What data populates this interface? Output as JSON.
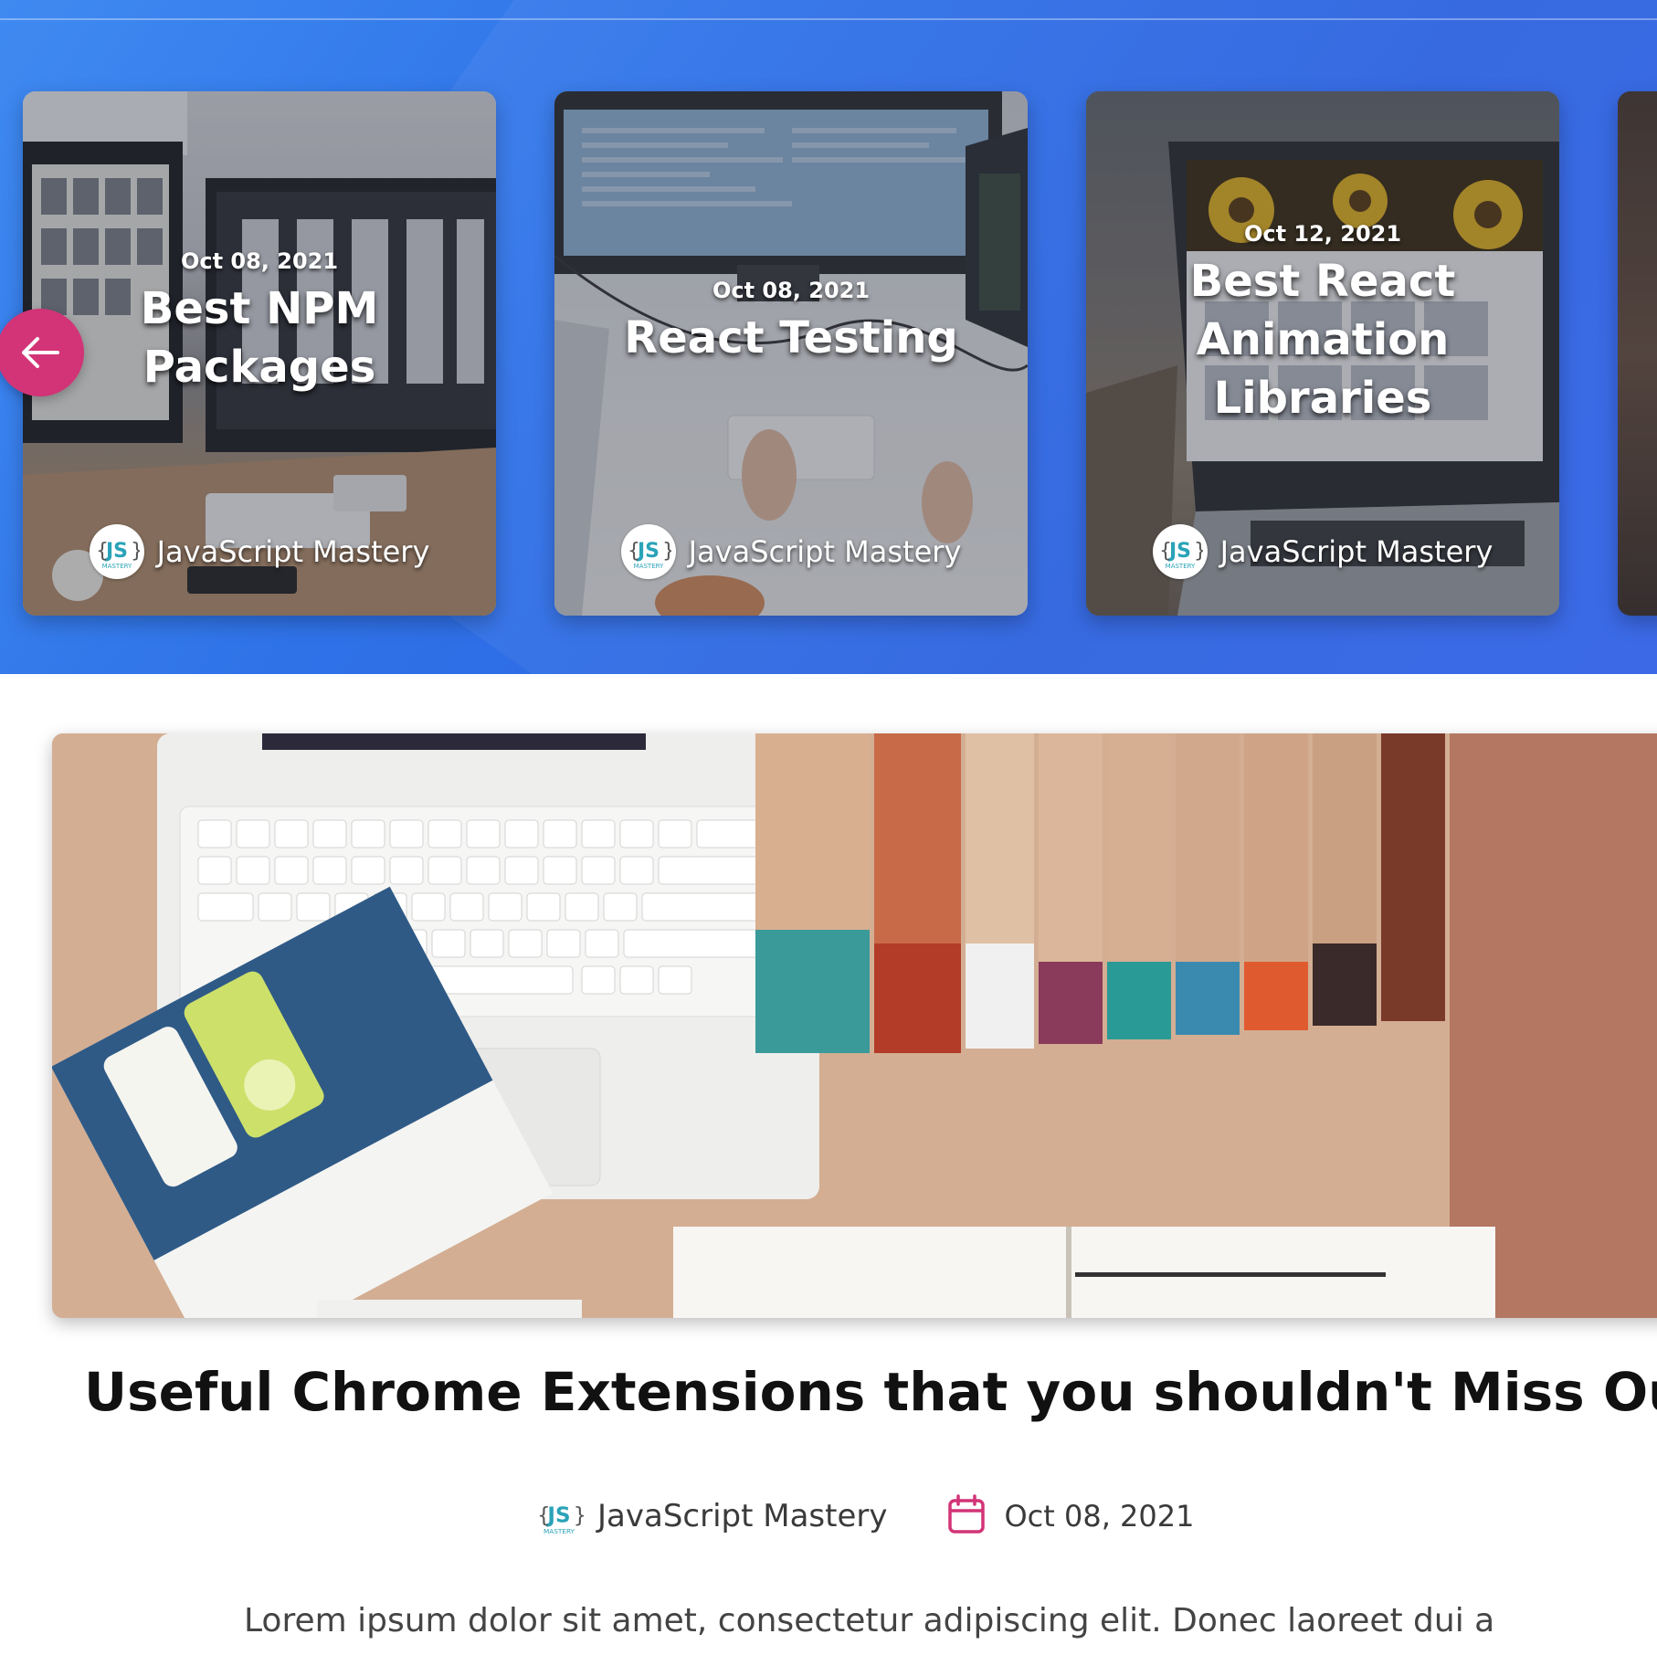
{
  "carousel": {
    "prev_arrow_icon": "arrow-left-icon",
    "accent_color": "#d23477",
    "cards": [
      {
        "date": "Oct 08, 2021",
        "title": "Best NPM Packages",
        "author": "JavaScript Mastery"
      },
      {
        "date": "Oct 08, 2021",
        "title": "React Testing",
        "author": "JavaScript Mastery"
      },
      {
        "date": "Oct 12, 2021",
        "title": "Best React Animation Libraries",
        "author": "JavaScript Mastery"
      }
    ]
  },
  "logo": {
    "text": "JS",
    "subtext": "MASTERY"
  },
  "article": {
    "title": "Useful Chrome Extensions that you shouldn't Miss Out",
    "author": "JavaScript Mastery",
    "date": "Oct 08, 2021",
    "calendar_icon": "calendar-icon",
    "body_start": "Lorem ipsum dolor sit amet, consectetur adipiscing elit. Donec laoreet dui a"
  }
}
